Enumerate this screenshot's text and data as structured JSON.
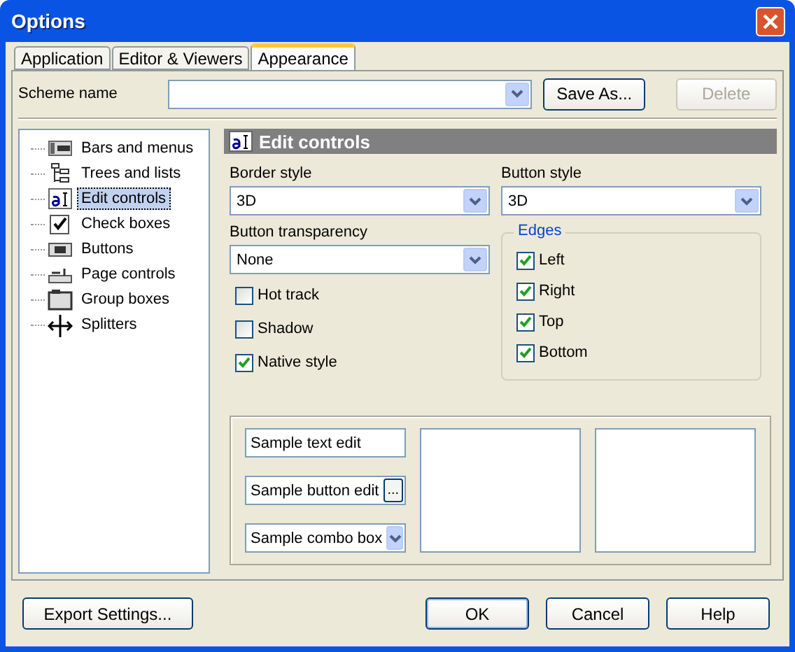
{
  "window": {
    "title": "Options"
  },
  "tabs": [
    {
      "label": "Application",
      "selected": false
    },
    {
      "label": "Editor & Viewers",
      "selected": false
    },
    {
      "label": "Appearance",
      "selected": true
    }
  ],
  "scheme": {
    "label": "Scheme name",
    "buttons": [
      {
        "label": "Save As...",
        "disabled": false
      },
      {
        "label": "Delete",
        "disabled": true
      }
    ]
  },
  "tree": {
    "items": [
      {
        "label": "Bars and menus",
        "kind": "bars",
        "selected": false
      },
      {
        "label": "Trees and lists",
        "kind": "tree",
        "selected": false
      },
      {
        "label": "Edit controls",
        "kind": "edit",
        "selected": true
      },
      {
        "label": "Check boxes",
        "kind": "check",
        "selected": false
      },
      {
        "label": "Buttons",
        "kind": "button",
        "selected": false
      },
      {
        "label": "Page controls",
        "kind": "page",
        "selected": false
      },
      {
        "label": "Group boxes",
        "kind": "group",
        "selected": false
      },
      {
        "label": "Splitters",
        "kind": "splitter",
        "selected": false
      }
    ]
  },
  "section": {
    "title": "Edit controls",
    "border_style": {
      "label": "Border style",
      "value": "3D"
    },
    "button_style": {
      "label": "Button style",
      "value": "3D"
    },
    "button_transparency": {
      "label": "Button transparency",
      "value": "None"
    },
    "options": [
      {
        "label": "Hot track",
        "checked": false
      },
      {
        "label": "Shadow",
        "checked": false
      },
      {
        "label": "Native style",
        "checked": true
      }
    ],
    "edges": {
      "title": "Edges",
      "items": [
        {
          "label": "Left",
          "checked": true
        },
        {
          "label": "Right",
          "checked": true
        },
        {
          "label": "Top",
          "checked": true
        },
        {
          "label": "Bottom",
          "checked": true
        }
      ]
    },
    "sample": {
      "text_edit": "Sample text edit",
      "button_edit": "Sample button edit",
      "button_edit_button": "...",
      "combo_box": "Sample combo box"
    }
  },
  "footer": [
    {
      "label": "Export Settings...",
      "default": false
    },
    {
      "label": "OK",
      "default": true
    },
    {
      "label": "Cancel",
      "default": false
    },
    {
      "label": "Help",
      "default": false
    }
  ]
}
